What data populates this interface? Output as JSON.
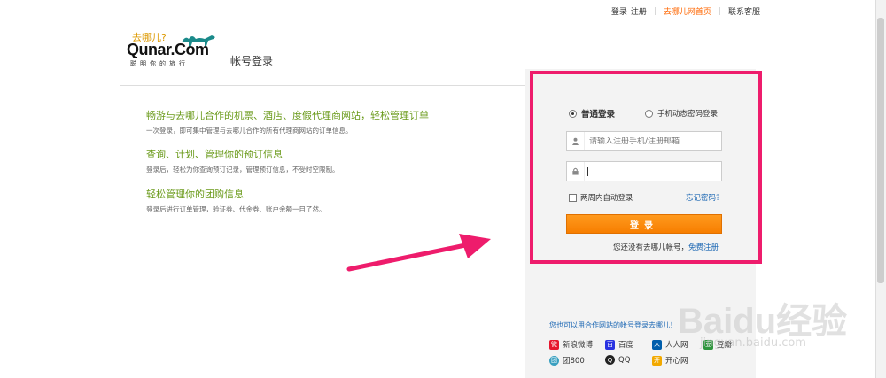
{
  "top_nav": {
    "login": "登录",
    "register": "注册",
    "home": "去哪儿网首页",
    "service": "联系客服"
  },
  "logo": {
    "cn": "去哪儿?",
    "en": "Qunar.Com",
    "slogan": "聪明你的旅行"
  },
  "page_title": "帐号登录",
  "features": [
    {
      "title": "畅游与去哪儿合作的机票、酒店、度假代理商网站，轻松管理订单",
      "desc": "一次登录，即可集中管理与去哪儿合作的所有代理商网站的订单信息。"
    },
    {
      "title": "查询、计划、管理你的预订信息",
      "desc": "登录后，轻松为你查询预订记录，管理预订信息，不受时空限制。"
    },
    {
      "title": "轻松管理你的团购信息",
      "desc": "登录后进行订单管理，验证券、代金券、账户余额一目了然。"
    }
  ],
  "login": {
    "mode_normal": "普通登录",
    "mode_sms": "手机动态密码登录",
    "username_placeholder": "请输入注册手机/注册邮箱",
    "password_value": "",
    "auto_login": "两周内自动登录",
    "forgot": "忘记密码?",
    "submit": "登录",
    "no_account": "您还没有去哪儿帐号，",
    "free_register": "免费注册"
  },
  "partners": {
    "title": "您也可以用合作网站的帐号登录去哪儿！",
    "items": [
      {
        "label": "新浪微博",
        "icon": "weibo-icon",
        "color": "#e6162d"
      },
      {
        "label": "百度",
        "icon": "baidu-icon",
        "color": "#2932e1"
      },
      {
        "label": "人人网",
        "icon": "renren-icon",
        "color": "#005eac"
      },
      {
        "label": "豆瓣",
        "icon": "douban-icon",
        "color": "#2e963d"
      },
      {
        "label": "团800",
        "icon": "tuan800-icon",
        "color": "#3aa0c0"
      },
      {
        "label": "QQ",
        "icon": "qq-icon",
        "color": "#222222"
      },
      {
        "label": "开心网",
        "icon": "kaixin-icon",
        "color": "#f2a900"
      }
    ]
  },
  "watermark": {
    "brand": "Baidu经验",
    "url": "jingyan.baidu.com"
  },
  "colors": {
    "accent_orange": "#f77e00",
    "highlight_pink": "#ee1c6c",
    "feature_green": "#6a9a1a",
    "link_blue": "#1a66b3"
  }
}
